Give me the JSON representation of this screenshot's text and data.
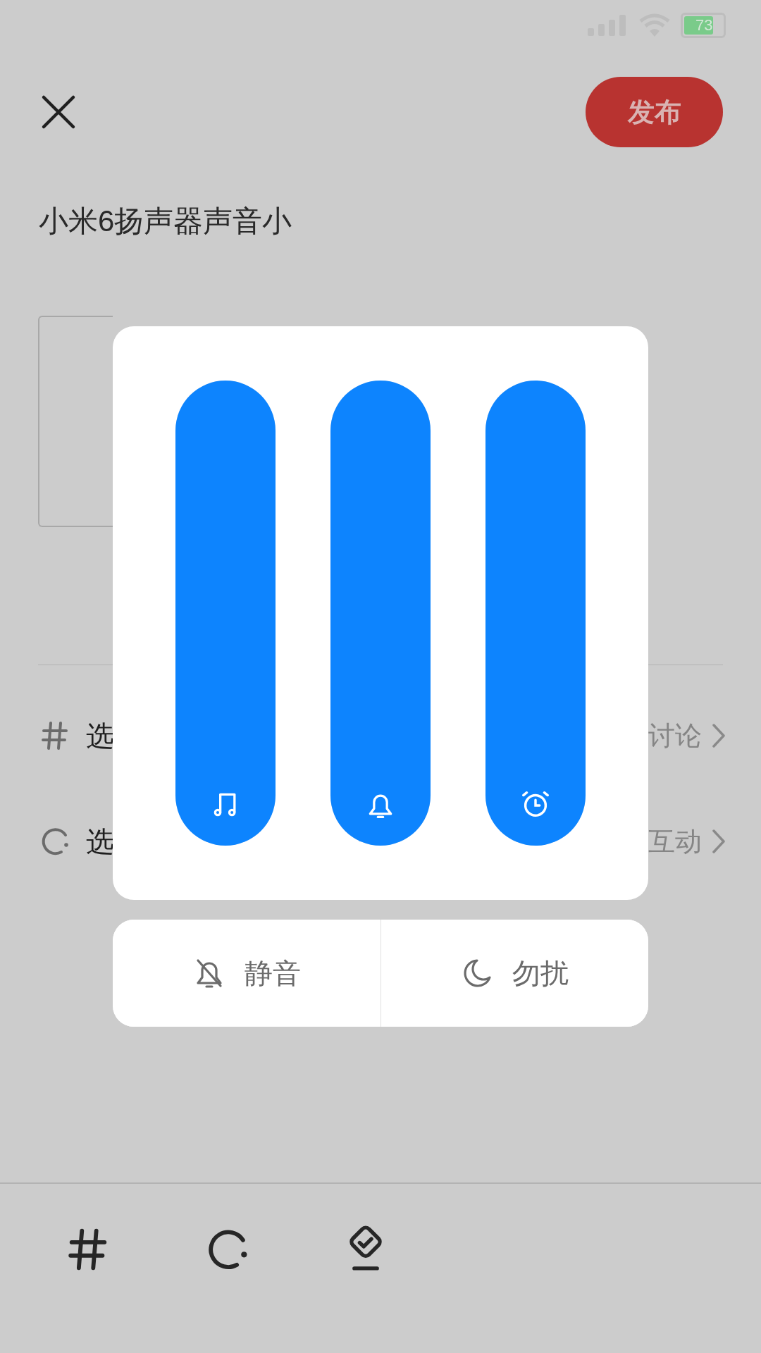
{
  "status_bar": {
    "battery": "73"
  },
  "header": {
    "publish_button": "发布"
  },
  "post": {
    "title": "小米6扬声器声音小"
  },
  "options": [
    {
      "kind": "topic",
      "label": "选",
      "value": "讨论"
    },
    {
      "kind": "circle",
      "label": "选",
      "value": "互动"
    }
  ],
  "volume_panel": {
    "sliders": [
      {
        "kind": "media",
        "level": 1
      },
      {
        "kind": "ring",
        "level": 1
      },
      {
        "kind": "alarm",
        "level": 1
      }
    ],
    "buttons": [
      {
        "kind": "mute",
        "label": "静音"
      },
      {
        "kind": "dnd",
        "label": "勿扰"
      }
    ]
  },
  "toolbar": [
    {
      "kind": "topic"
    },
    {
      "kind": "circle"
    },
    {
      "kind": "task"
    }
  ]
}
